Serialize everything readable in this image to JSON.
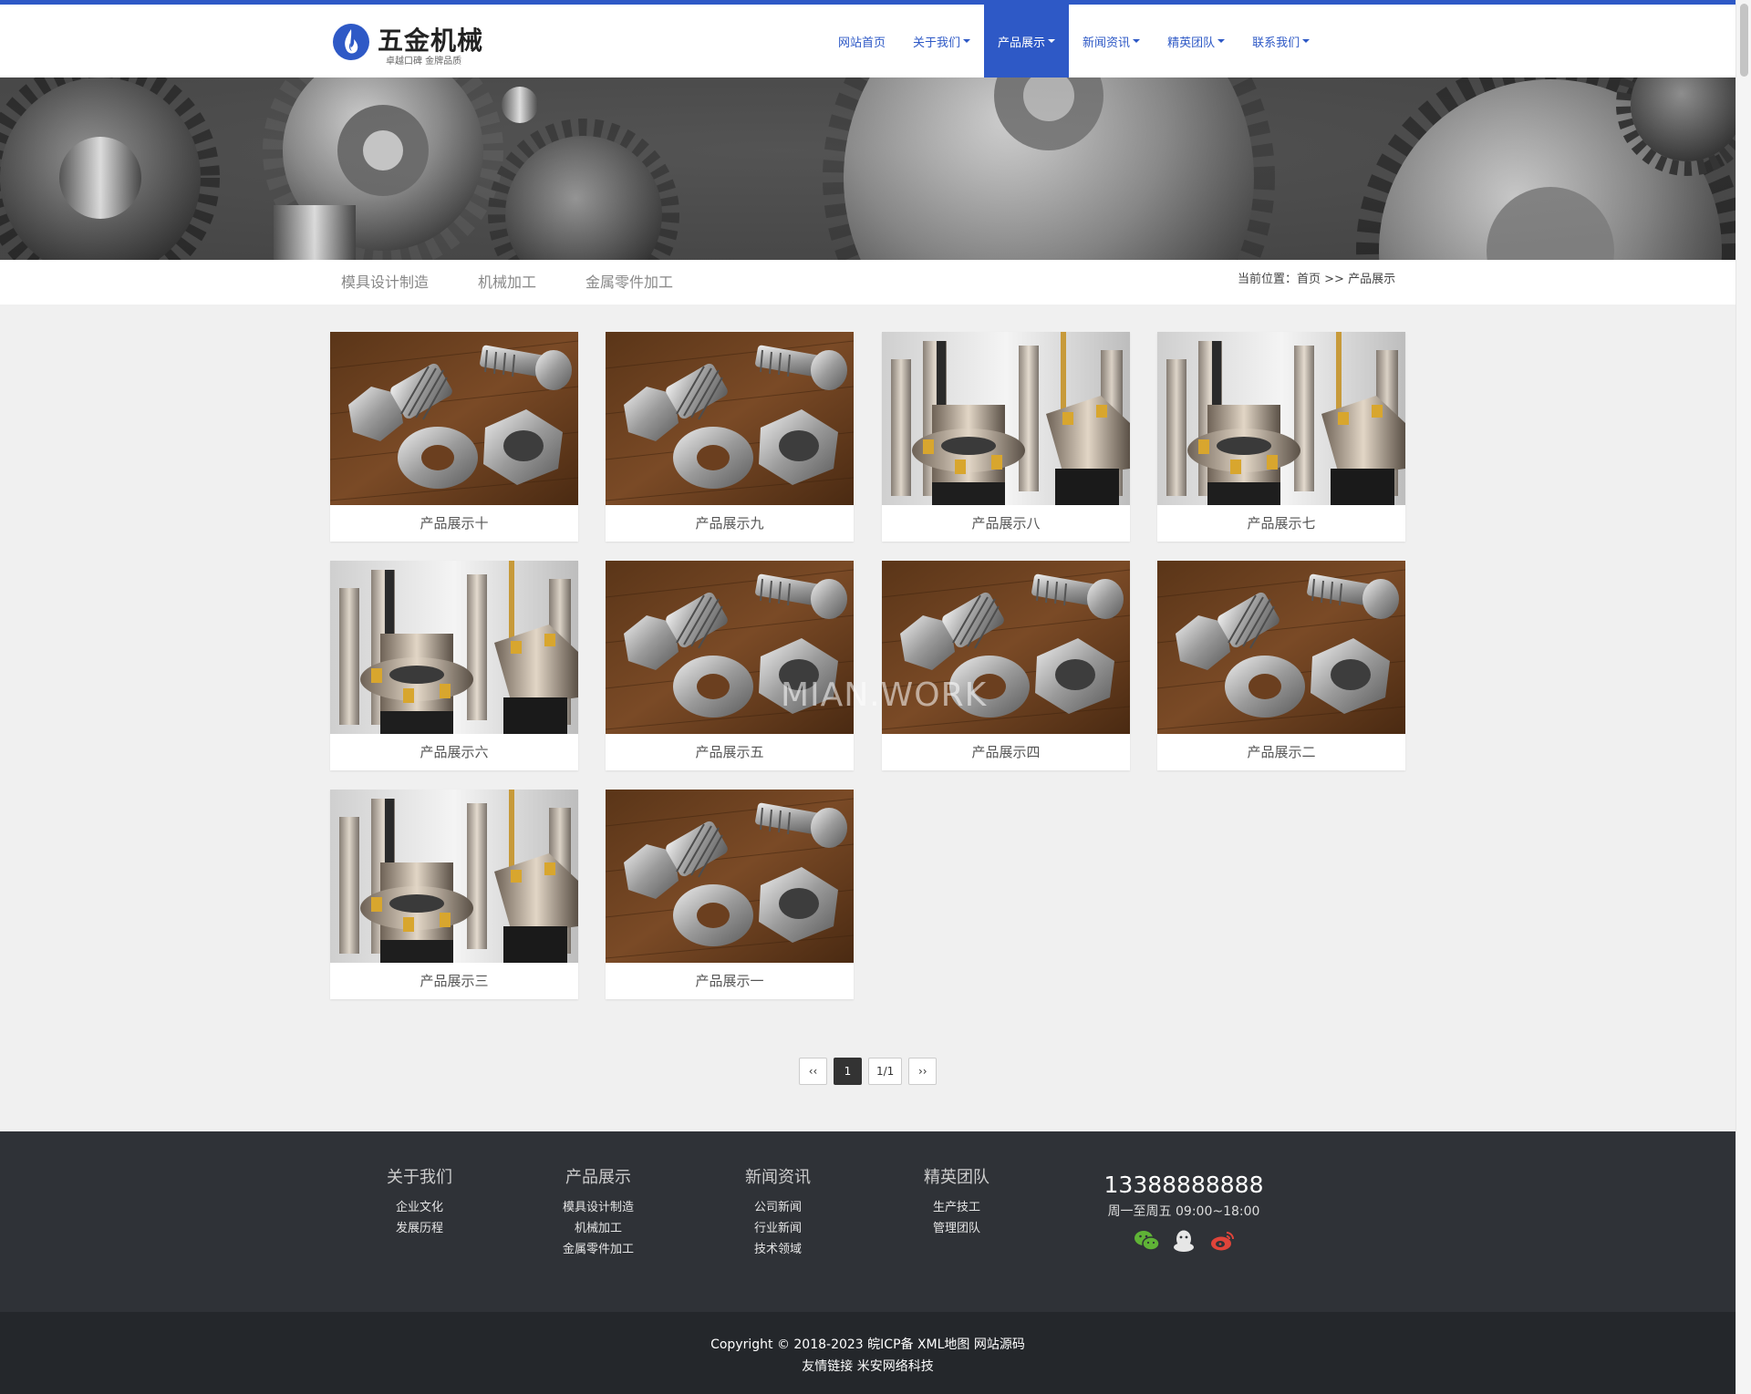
{
  "site": {
    "logo_title": "五金机械",
    "logo_slogan": "卓越口碑 金牌品质"
  },
  "nav": [
    {
      "label": "网站首页",
      "dropdown": false,
      "active": false
    },
    {
      "label": "关于我们",
      "dropdown": true,
      "active": false
    },
    {
      "label": "产品展示",
      "dropdown": true,
      "active": true
    },
    {
      "label": "新闻资讯",
      "dropdown": true,
      "active": false
    },
    {
      "label": "精英团队",
      "dropdown": true,
      "active": false
    },
    {
      "label": "联系我们",
      "dropdown": true,
      "active": false
    }
  ],
  "subnav": {
    "links": [
      "模具设计制造",
      "机械加工",
      "金属零件加工"
    ],
    "breadcrumb_prefix": "当前位置：",
    "breadcrumb_home": "首页",
    "breadcrumb_sep": " >> ",
    "breadcrumb_current": "产品展示"
  },
  "products": [
    {
      "title": "产品展示十",
      "image": "bolts"
    },
    {
      "title": "产品展示九",
      "image": "bolts"
    },
    {
      "title": "产品展示八",
      "image": "tools"
    },
    {
      "title": "产品展示七",
      "image": "tools"
    },
    {
      "title": "产品展示六",
      "image": "tools"
    },
    {
      "title": "产品展示五",
      "image": "bolts"
    },
    {
      "title": "产品展示四",
      "image": "bolts"
    },
    {
      "title": "产品展示二",
      "image": "bolts"
    },
    {
      "title": "产品展示三",
      "image": "tools"
    },
    {
      "title": "产品展示一",
      "image": "bolts"
    }
  ],
  "watermark": "MIAN.WORK",
  "pagination": {
    "prev": "‹‹",
    "current": "1",
    "total": "1/1",
    "next": "››"
  },
  "footer": {
    "columns": [
      {
        "title": "关于我们",
        "links": [
          "企业文化",
          "发展历程"
        ]
      },
      {
        "title": "产品展示",
        "links": [
          "模具设计制造",
          "机械加工",
          "金属零件加工"
        ]
      },
      {
        "title": "新闻资讯",
        "links": [
          "公司新闻",
          "行业新闻",
          "技术领域"
        ]
      },
      {
        "title": "精英团队",
        "links": [
          "生产技工",
          "管理团队"
        ]
      }
    ],
    "phone": "13388888888",
    "hours": "周一至周五 09:00~18:00",
    "social_icons": [
      "wechat-icon",
      "qq-icon",
      "weibo-icon"
    ]
  },
  "copyright": {
    "line1": "Copyright © 2018-2023 皖ICP备 XML地图 网站源码",
    "line2": "友情链接 米安网络科技"
  },
  "colors": {
    "accent": "#2e59c6",
    "footer_bg": "#2f3237",
    "copyright_bg": "#24272b",
    "page_bg": "#f0f0f0"
  }
}
